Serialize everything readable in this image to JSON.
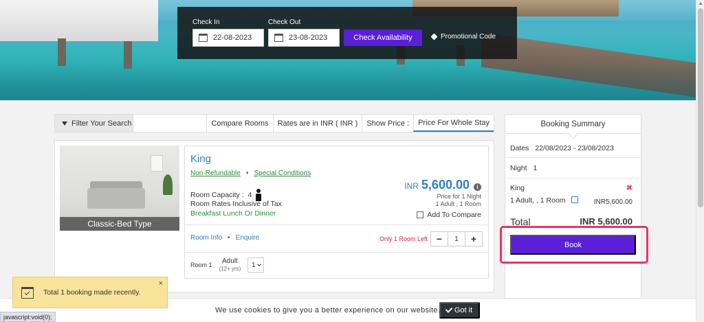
{
  "search": {
    "check_in_label": "Check In",
    "check_in_value": "22-08-2023",
    "check_out_label": "Check Out",
    "check_out_value": "23-08-2023",
    "check_availability": "Check Availability",
    "promo_code": "Promotional Code"
  },
  "filter_bar": {
    "filter_label": "Filter Your Search",
    "compare_rooms": "Compare Rooms",
    "rates_currency": "Rates are in INR ( INR )",
    "show_price_label": "Show Price :",
    "show_price_value": "Price For Whole Stay"
  },
  "room": {
    "image_caption": "Classic-Bed Type",
    "name": "King",
    "policy_refund": "Non-Refundable",
    "policy_separator": "•",
    "policy_conditions": "Special Conditions",
    "capacity_label": "Room Capacity :",
    "capacity_value": "4",
    "rates_tax": "Room Rates Inclusive of Tax",
    "meals": "Breakfast Lunch Or Dinner",
    "price_currency": "INR",
    "price_value": "5,600.00",
    "price_note_1": "Price for 1 Night",
    "price_note_2": "1 Adult , 1 Room",
    "add_to_compare": "Add To Compare",
    "link_room_info": "Room Info",
    "link_separator": "•",
    "link_enquire": "Enquire",
    "rooms_left": "Only 1 Room Left",
    "stepper_minus": "−",
    "stepper_value": "1",
    "stepper_plus": "+",
    "room_line_label": "Room 1",
    "adult_label": "Adult",
    "adult_sub": "(12+ yrs)",
    "adult_value": "1"
  },
  "summary": {
    "title": "Booking Summary",
    "dates_label": "Dates",
    "dates_value": "22/08/2023 - 23/08/2023",
    "night_label": "Night",
    "night_value": "1",
    "room_name": "King",
    "room_remove": "✖",
    "room_guests": "1 Adult, , 1 Room",
    "room_price": "INR5,600.00",
    "total_label": "Total",
    "total_value": "INR 5,600.00",
    "book_label": "Book"
  },
  "toast": {
    "message": "Total 1 booking made recently.",
    "close": "×"
  },
  "cookie": {
    "message": "We use cookies to give you a better experience on our website.",
    "button": "Got it"
  },
  "status_bar": {
    "text": "javascript:void(0);"
  },
  "colors": {
    "accent": "#5a1fd6",
    "link": "#2b7fc3",
    "success": "#2e8b3c",
    "alert": "#d6262b",
    "highlight": "#e8336b"
  }
}
